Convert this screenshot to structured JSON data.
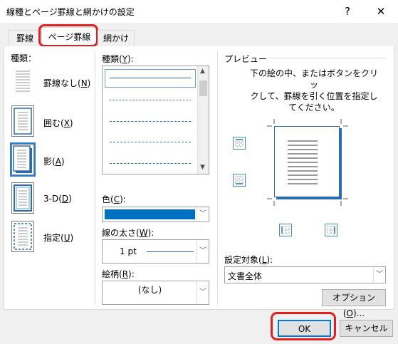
{
  "window": {
    "title": "線種とページ罫線と網かけの設定",
    "help_label": "?",
    "close_label": "✕"
  },
  "tabs": [
    {
      "label": "罫線"
    },
    {
      "label": "ページ罫線"
    },
    {
      "label": "網かけ"
    }
  ],
  "settings": {
    "heading": "種類：",
    "items": [
      {
        "label": "罫線なし(",
        "key": "N",
        "suffix": ")"
      },
      {
        "label": "囲む(",
        "key": "X",
        "suffix": ")"
      },
      {
        "label": "影(",
        "key": "A",
        "suffix": ")"
      },
      {
        "label": "3-D(",
        "key": "D",
        "suffix": ")"
      },
      {
        "label": "指定(",
        "key": "U",
        "suffix": ")"
      }
    ]
  },
  "style": {
    "label": "種類(",
    "key": "Y",
    "suffix": "):"
  },
  "color": {
    "label": "色(",
    "key": "C",
    "suffix": "):",
    "value": "#0070c0"
  },
  "width": {
    "label": "線の太さ(",
    "key": "W",
    "suffix": "):",
    "value": "1 pt"
  },
  "art": {
    "label": "絵柄(",
    "key": "R",
    "suffix": "):",
    "value": "(なし)"
  },
  "preview": {
    "heading": "プレビュー",
    "instructions_line1": "下の絵の中、またはボタンをクリッ",
    "instructions_line2": "クして、罫線を引く位置を指定し",
    "instructions_line3": "てください。"
  },
  "apply_to": {
    "label": "設定対象(",
    "key": "L",
    "suffix": "):",
    "value": "文書全体"
  },
  "buttons": {
    "options": "オプション(",
    "options_key": "O",
    "options_suffix": ")...",
    "ok": "OK",
    "cancel": "キャンセル"
  },
  "colors": {
    "accent": "#0070c0",
    "highlight": "#e02020"
  }
}
